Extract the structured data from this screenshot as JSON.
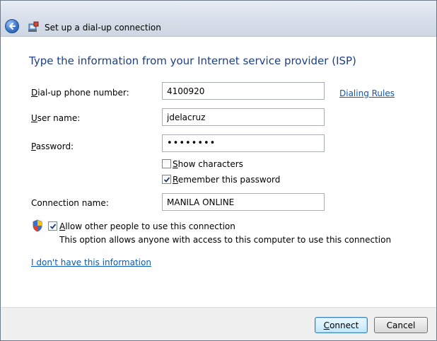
{
  "window": {
    "title": "Set up a dial-up connection",
    "back_icon": "back-arrow-icon",
    "title_icon": "dialup-connection-icon"
  },
  "heading": "Type the information from your Internet service provider (ISP)",
  "form": {
    "phone": {
      "label_key": "D",
      "label_rest": "ial-up phone number:",
      "value": "4100920"
    },
    "username": {
      "label_key": "U",
      "label_rest": "ser name:",
      "value": "jdelacruz"
    },
    "password": {
      "label_key": "P",
      "label_rest": "assword:",
      "value": "••••••••"
    },
    "show_characters": {
      "label_key": "S",
      "label_rest": "how characters",
      "checked": false
    },
    "remember_password": {
      "label_key": "R",
      "label_rest": "emember this password",
      "checked": true
    },
    "connection_name": {
      "label": "Connection name:",
      "value": "MANILA ONLINE"
    },
    "allow_others": {
      "label_key": "A",
      "label_rest": "llow other people to use this connection",
      "checked": true,
      "note": "This option allows anyone with access to this computer to use this connection"
    }
  },
  "links": {
    "dialing_rules": "Dialing Rules",
    "no_info": "I don't have this information"
  },
  "buttons": {
    "connect_key": "C",
    "connect_rest": "onnect",
    "cancel": "Cancel"
  },
  "colors": {
    "heading": "#1b3f8c",
    "link": "#0b5bb7",
    "titlebar": "#d6dee9"
  }
}
